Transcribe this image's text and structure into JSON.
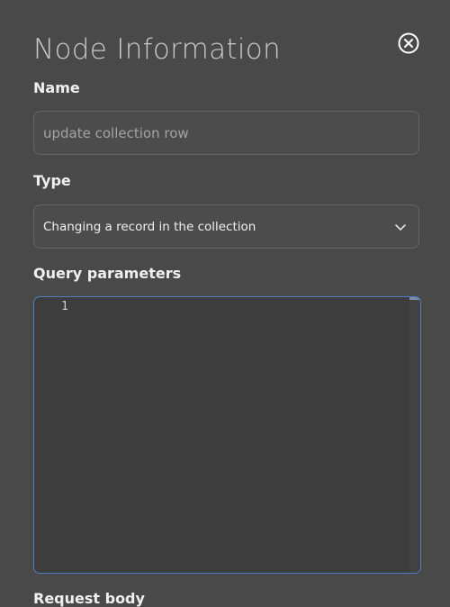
{
  "panel": {
    "title": "Node Information",
    "close_icon": "close-circle-icon"
  },
  "name": {
    "label": "Name",
    "placeholder": "update collection row",
    "value": ""
  },
  "type": {
    "label": "Type",
    "selected": "Changing a record in the collection",
    "icon": "chevron-down-icon"
  },
  "query_parameters": {
    "label": "Query parameters",
    "line_numbers": [
      "1"
    ],
    "content": ""
  },
  "request_body": {
    "label": "Request body"
  },
  "colors": {
    "background": "#4a4949",
    "editor_focus_border": "#4f7fc3",
    "text": "#f0f0f0",
    "placeholder": "#a3a3a3"
  }
}
